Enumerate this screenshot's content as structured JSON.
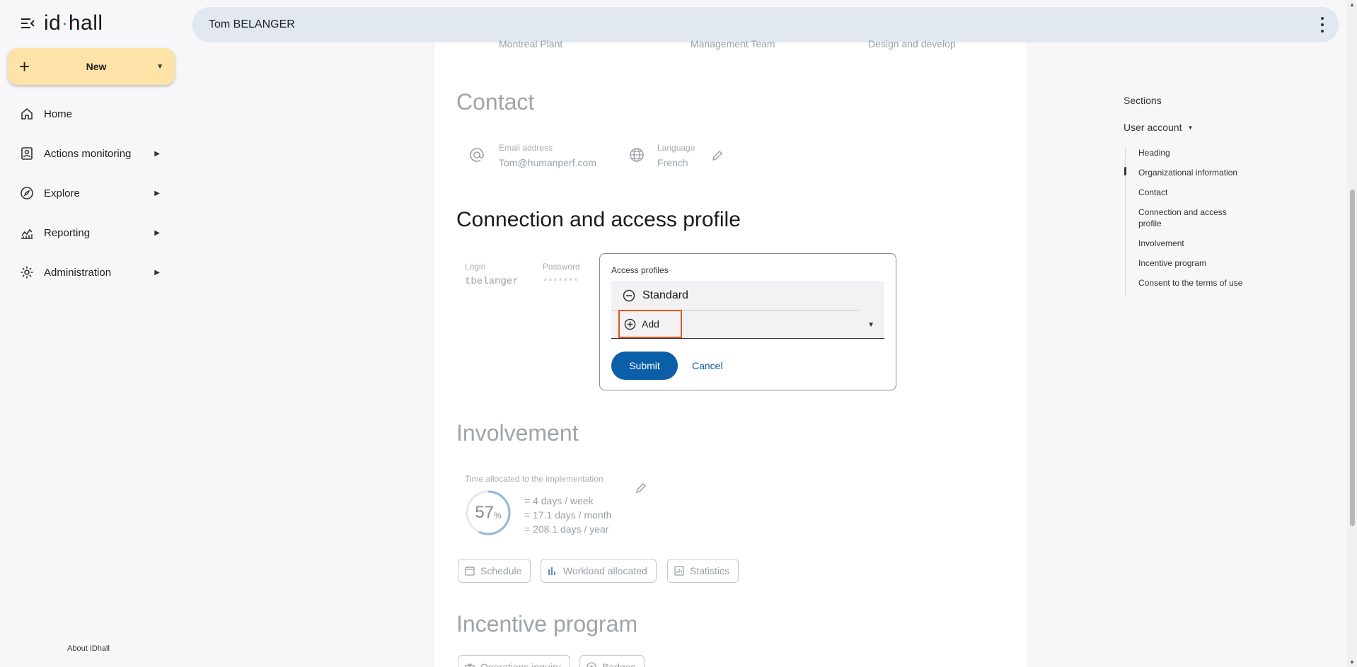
{
  "app": {
    "logo": "idhall"
  },
  "sidebar": {
    "new_label": "New",
    "items": [
      {
        "label": "Home",
        "icon": "home-icon"
      },
      {
        "label": "Actions monitoring",
        "icon": "clipboard-user-icon"
      },
      {
        "label": "Explore",
        "icon": "compass-icon"
      },
      {
        "label": "Reporting",
        "icon": "chart-icon"
      },
      {
        "label": "Administration",
        "icon": "gear-icon"
      }
    ],
    "about": "About IDhall"
  },
  "header": {
    "title": "Tom BELANGER"
  },
  "main": {
    "top_row": [
      "Montreal Plant",
      "Management Team",
      "Design and develop"
    ],
    "contact": {
      "title": "Contact",
      "email_label": "Email address",
      "email_value": "Tom@humanperf.com",
      "language_label": "Language",
      "language_value": "French"
    },
    "connection": {
      "title": "Connection and access profile",
      "login_label": "Login",
      "login_value": "tbelanger",
      "password_label": "Password",
      "password_value": "*******",
      "access_profiles_label": "Access profiles",
      "profile": "Standard",
      "add_label": "Add",
      "submit_label": "Submit",
      "cancel_label": "Cancel"
    },
    "involvement": {
      "title": "Involvement",
      "time_label": "Time allocated to the implementation",
      "percent": "57",
      "percent_unit": "%",
      "percent_value": 57,
      "week": "= 4 days / week",
      "month": "= 17.1 days / month",
      "year": "= 208.1 days / year",
      "buttons": [
        "Schedule",
        "Workload allocated",
        "Statistics"
      ]
    },
    "incentive": {
      "title": "Incentive program",
      "buttons": [
        "Operations inquiry",
        "Badges"
      ]
    }
  },
  "sections_panel": {
    "title": "Sections",
    "user_account": "User account",
    "items": [
      "Heading",
      "Organizational information",
      "Contact",
      "Connection and access profile",
      "Involvement",
      "Incentive program",
      "Consent to the terms of use"
    ],
    "active_index": 1
  },
  "colors": {
    "accent": "#0b5ea8",
    "new_button": "#fde3a7",
    "highlight": "#e0561a"
  }
}
